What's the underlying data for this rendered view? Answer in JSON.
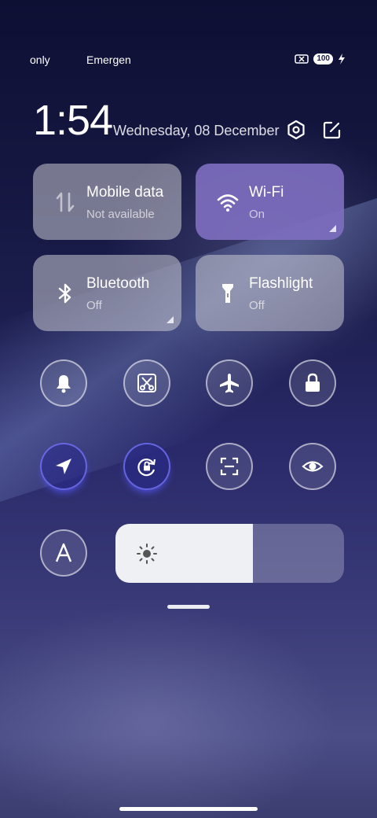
{
  "status_bar": {
    "left_text": "only",
    "mid_text": "Emergency",
    "sim_icon": "sim-cross-icon",
    "battery_level": "100",
    "charging_icon": "bolt-icon"
  },
  "header": {
    "time": "1:54",
    "date": "Wednesday, 08 December"
  },
  "tiles": [
    {
      "title": "Mobile data",
      "status": "Not available",
      "icon": "mobile-data-icon"
    },
    {
      "title": "Wi-Fi",
      "status": "On",
      "icon": "wifi-icon"
    },
    {
      "title": "Bluetooth",
      "status": "Off",
      "icon": "bluetooth-icon"
    },
    {
      "title": "Flashlight",
      "status": "Off",
      "icon": "flashlight-icon"
    }
  ],
  "toggles": [
    {
      "name": "ringer",
      "icon": "bell-icon",
      "on": false
    },
    {
      "name": "screenshot",
      "icon": "scissors-icon",
      "on": false
    },
    {
      "name": "airplane-mode",
      "icon": "airplane-icon",
      "on": false
    },
    {
      "name": "lock-screen",
      "icon": "lock-icon",
      "on": false
    },
    {
      "name": "location",
      "icon": "location-arrow-icon",
      "on": true
    },
    {
      "name": "rotation-lock",
      "icon": "rotation-lock-icon",
      "on": true
    },
    {
      "name": "scanner",
      "icon": "scan-icon",
      "on": false
    },
    {
      "name": "reading-mode",
      "icon": "eye-icon",
      "on": false
    },
    {
      "name": "auto-brightness",
      "icon": "auto-a-icon",
      "on": false
    }
  ],
  "brightness": {
    "level_percent": 60,
    "icon": "sun-icon"
  },
  "colors": {
    "active_tile": "#7d6ebe",
    "brightness_fill": "#eef0f4"
  }
}
